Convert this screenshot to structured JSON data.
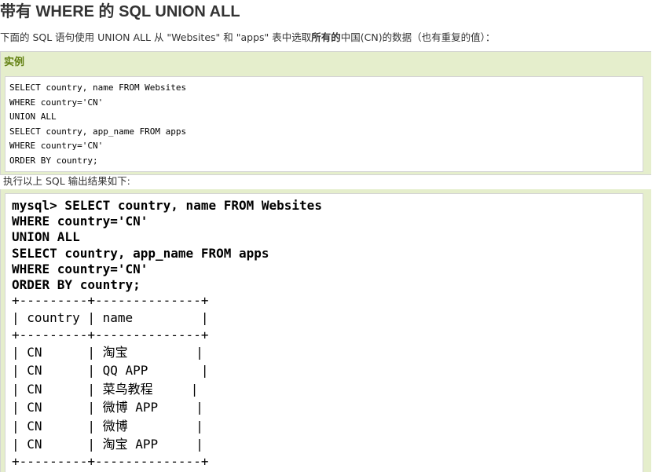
{
  "page": {
    "title": "带有 WHERE 的 SQL UNION ALL",
    "intro_pre": "下面的 SQL 语句使用 UNION ALL 从 \"Websites\" 和 \"apps\" 表中选取",
    "intro_bold": "所有的",
    "intro_post": "中国(CN)的数据（也有重复的值）："
  },
  "example": {
    "label": "实例",
    "code": "SELECT country, name FROM Websites\nWHERE country='CN'\nUNION ALL\nSELECT country, app_name FROM apps\nWHERE country='CN'\nORDER BY country;"
  },
  "result": {
    "label": "执行以上 SQL 输出结果如下:",
    "query": "mysql> SELECT country, name FROM Websites\nWHERE country='CN'\nUNION ALL\nSELECT country, app_name FROM apps\nWHERE country='CN'\nORDER BY country;",
    "table_border": "+---------+--------------+",
    "table_header": "| country | name         |",
    "table_rows": [
      "| CN      | 淘宝         |",
      "| CN      | QQ APP       |",
      "| CN      | 菜鸟教程     |",
      "| CN      | 微博 APP     |",
      "| CN      | 微博         |",
      "| CN      | 淘宝 APP     |"
    ]
  },
  "colors": {
    "example_bg": "#e5eecc",
    "example_label": "#617f10",
    "border": "#d4d4d4"
  }
}
